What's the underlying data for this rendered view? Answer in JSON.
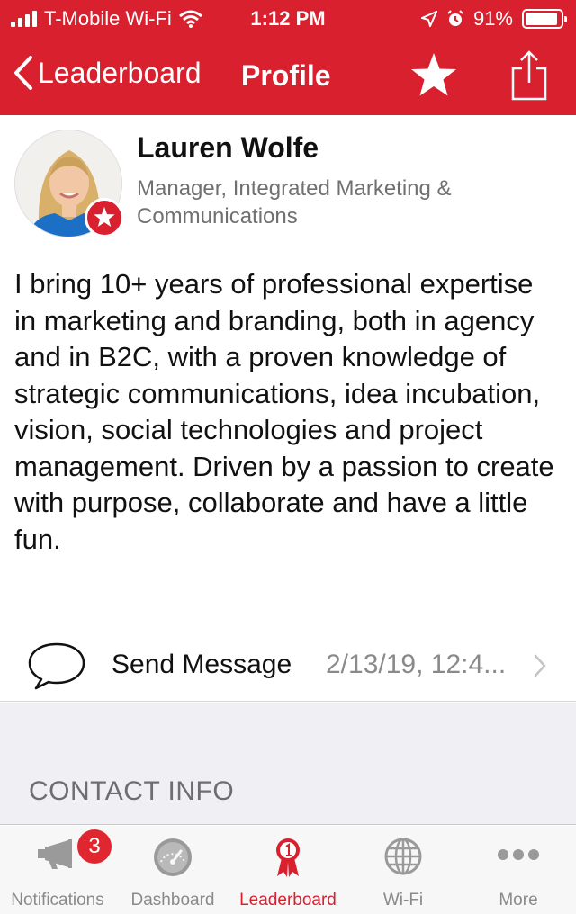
{
  "status_bar": {
    "carrier": "T-Mobile Wi-Fi",
    "time": "1:12 PM",
    "battery": "91%",
    "battery_level": 0.91
  },
  "nav": {
    "back_label": "Leaderboard",
    "title": "Profile",
    "icons": [
      "chevron-left-icon",
      "star-icon",
      "share-icon"
    ]
  },
  "profile": {
    "name": "Lauren Wolfe",
    "role": "Manager, Integrated Marketing & Communications",
    "bio": "I bring 10+ years of professional expertise in marketing and branding, both in agency and in B2C, with a proven knowledge of strategic communications, idea incubation, vision, social technologies and project management. Driven by a passion to create with purpose, collaborate and have a little fun."
  },
  "message": {
    "label": "Send Message",
    "date": "2/13/19, 12:4..."
  },
  "section": {
    "title": "CONTACT INFO"
  },
  "tabs": [
    {
      "label": "Notifications",
      "icon": "megaphone-icon",
      "badge": "3"
    },
    {
      "label": "Dashboard",
      "icon": "speedometer-icon"
    },
    {
      "label": "Leaderboard",
      "icon": "ribbon-icon",
      "active": true
    },
    {
      "label": "Wi-Fi",
      "icon": "globe-icon"
    },
    {
      "label": "More",
      "icon": "more-icon"
    }
  ],
  "colors": {
    "brand_red": "#d9202e",
    "tab_inactive": "#8a8a8a",
    "section_bg": "#efeff4"
  }
}
